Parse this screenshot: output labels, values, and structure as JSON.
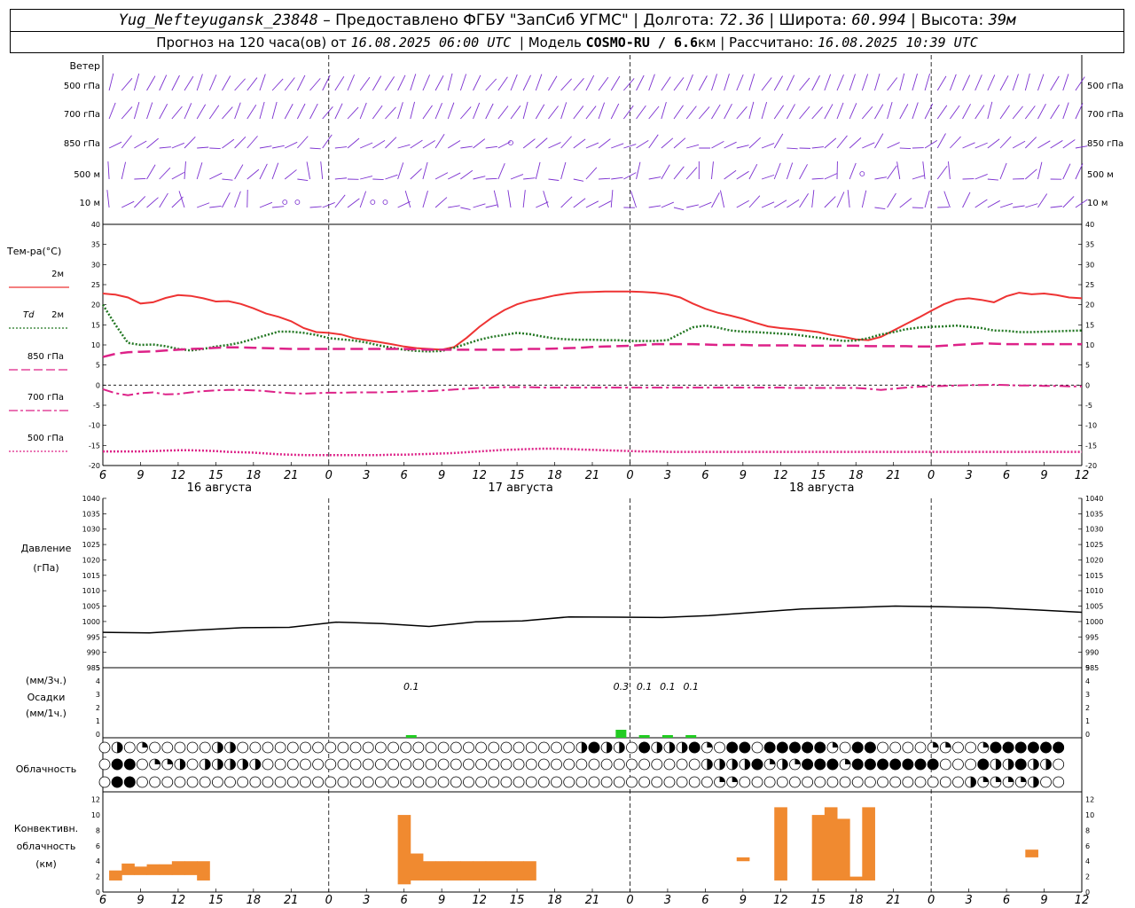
{
  "header": {
    "station": "Yug_Nefteyugansk_23848",
    "dash": " – ",
    "provider": "Предоставлено ФГБУ \"ЗапСиб УГМС\"",
    "lon_label": "Долгота:",
    "lon_value": "72.36",
    "lat_label": "Широта:",
    "lat_value": "60.994",
    "alt_label": "Высота:",
    "alt_value": "39м",
    "sep": " | ",
    "forecast_text": "Прогноз на 120 часа(ов) от ",
    "forecast_time": "16.08.2025 06:00 UTC",
    "model_label": "Модель ",
    "model_name": "COSMO-RU / 6.6",
    "model_res_unit": "км",
    "calc_label": "Рассчитано: ",
    "calc_time": "16.08.2025 10:39 UTC"
  },
  "time_axis": {
    "tick_labels": [
      "6",
      "9",
      "12",
      "15",
      "18",
      "21",
      "0",
      "3",
      "6",
      "9",
      "12",
      "15",
      "18",
      "21",
      "0",
      "3",
      "6",
      "9",
      "12",
      "15",
      "18",
      "21",
      "0",
      "3",
      "6",
      "9",
      "12"
    ],
    "day_labels": [
      "16 августа",
      "17 августа",
      "18 августа"
    ]
  },
  "wind_panel": {
    "title": "Ветер",
    "levels": [
      "500 гПа",
      "700 гПа",
      "850 гПа",
      "500 м",
      "10 м"
    ],
    "colors": {
      "barb": "#7b2fd0",
      "calm_circle": "#7b2fd0"
    }
  },
  "chart_data": [
    {
      "type": "line",
      "title": "Тем-ра(°C)",
      "ylim": [
        -20,
        40
      ],
      "y_ticks": [
        "40",
        "35",
        "30",
        "25",
        "20",
        "15",
        "10",
        "5",
        "0",
        "-5",
        "-10",
        "-15",
        "-20"
      ],
      "x_hours": [
        0,
        1,
        2,
        3,
        4,
        5,
        6,
        7,
        8,
        9,
        10,
        11,
        12,
        13,
        14,
        15,
        16,
        17,
        18,
        19,
        20,
        21,
        22,
        23,
        24,
        25,
        26,
        27,
        28,
        29,
        30,
        31,
        32,
        33,
        34,
        35,
        36,
        37,
        38,
        39,
        40,
        41,
        42,
        43,
        44,
        45,
        46,
        47,
        48,
        49,
        50,
        51,
        52,
        53,
        54,
        55,
        56,
        57,
        58,
        59,
        60,
        61,
        62,
        63,
        64,
        65,
        66,
        67,
        68,
        69,
        70,
        71,
        72,
        73,
        74,
        75,
        76,
        77,
        78
      ],
      "series": [
        {
          "name": "2м",
          "color": "#ee3333",
          "style": "solid",
          "values": [
            22.8,
            22.5,
            21.8,
            20.3,
            20.6,
            21.7,
            22.4,
            22.2,
            21.6,
            20.8,
            20.9,
            20.2,
            19.1,
            17.8,
            17.0,
            15.9,
            14.2,
            13.2,
            13.0,
            12.6,
            11.7,
            11.2,
            10.7,
            10.2,
            9.6,
            9.2,
            9.0,
            8.8,
            9.5,
            11.8,
            14.5,
            16.8,
            18.7,
            20.1,
            21.0,
            21.6,
            22.3,
            22.8,
            23.1,
            23.2,
            23.3,
            23.3,
            23.3,
            23.2,
            23.0,
            22.6,
            21.8,
            20.3,
            19.0,
            18.0,
            17.3,
            16.5,
            15.5,
            14.6,
            14.2,
            13.9,
            13.6,
            13.2,
            12.5,
            12.0,
            11.4,
            11.2,
            12.0,
            13.6,
            15.2,
            16.8,
            18.5,
            20.1,
            21.3,
            21.6,
            21.2,
            20.6,
            22.1,
            23.0,
            22.6,
            22.8,
            22.4,
            21.8,
            21.6
          ]
        },
        {
          "name": "Td 2м",
          "color": "#227722",
          "style": "dotted",
          "values": [
            20.0,
            15.0,
            10.5,
            10.0,
            10.1,
            9.7,
            9.0,
            8.6,
            9.0,
            9.6,
            10.0,
            10.6,
            11.5,
            12.4,
            13.3,
            13.3,
            13.0,
            12.5,
            11.7,
            11.4,
            11.1,
            10.6,
            9.9,
            9.3,
            8.8,
            8.5,
            8.4,
            8.5,
            9.3,
            10.3,
            11.3,
            12.0,
            12.5,
            13.0,
            12.7,
            12.1,
            11.6,
            11.4,
            11.3,
            11.3,
            11.2,
            11.2,
            11.0,
            11.0,
            11.0,
            11.2,
            12.8,
            14.4,
            14.8,
            14.3,
            13.6,
            13.3,
            13.2,
            13.0,
            12.8,
            12.6,
            12.2,
            11.8,
            11.4,
            11.0,
            11.1,
            11.7,
            12.6,
            13.2,
            13.9,
            14.3,
            14.5,
            14.6,
            14.8,
            14.5,
            14.2,
            13.6,
            13.5,
            13.2,
            13.2,
            13.3,
            13.4,
            13.5,
            13.6
          ]
        },
        {
          "name": "850 гПа",
          "color": "#dd2288",
          "style": "longdash",
          "values": [
            7.0,
            7.8,
            8.2,
            8.3,
            8.4,
            8.6,
            8.8,
            9.0,
            9.1,
            9.3,
            9.4,
            9.4,
            9.3,
            9.2,
            9.1,
            9.0,
            9.0,
            9.0,
            9.0,
            9.0,
            9.0,
            9.0,
            9.0,
            9.0,
            9.0,
            8.9,
            8.8,
            8.8,
            8.8,
            8.8,
            8.8,
            8.8,
            8.8,
            8.8,
            9.0,
            9.0,
            9.1,
            9.2,
            9.3,
            9.5,
            9.6,
            9.7,
            9.8,
            10.0,
            10.2,
            10.2,
            10.2,
            10.2,
            10.1,
            10.0,
            10.0,
            10.0,
            9.9,
            9.9,
            9.9,
            9.9,
            9.8,
            9.8,
            9.8,
            9.8,
            9.8,
            9.7,
            9.7,
            9.7,
            9.7,
            9.6,
            9.6,
            9.8,
            10.0,
            10.2,
            10.4,
            10.3,
            10.2,
            10.2,
            10.2,
            10.2,
            10.2,
            10.2,
            10.2
          ]
        },
        {
          "name": "700 гПа",
          "color": "#dd2288",
          "style": "dashdot",
          "values": [
            -1.0,
            -2.0,
            -2.5,
            -2.0,
            -1.8,
            -2.3,
            -2.2,
            -1.8,
            -1.5,
            -1.3,
            -1.2,
            -1.2,
            -1.3,
            -1.5,
            -1.8,
            -2.0,
            -2.1,
            -2.0,
            -1.9,
            -1.9,
            -1.8,
            -1.8,
            -1.8,
            -1.7,
            -1.6,
            -1.5,
            -1.5,
            -1.3,
            -1.1,
            -0.9,
            -0.7,
            -0.6,
            -0.5,
            -0.5,
            -0.5,
            -0.6,
            -0.6,
            -0.6,
            -0.6,
            -0.6,
            -0.6,
            -0.6,
            -0.6,
            -0.6,
            -0.6,
            -0.6,
            -0.6,
            -0.6,
            -0.6,
            -0.6,
            -0.6,
            -0.6,
            -0.6,
            -0.6,
            -0.6,
            -0.7,
            -0.7,
            -0.7,
            -0.7,
            -0.7,
            -0.7,
            -0.9,
            -1.2,
            -0.9,
            -0.6,
            -0.4,
            -0.3,
            -0.2,
            -0.1,
            0.0,
            0.0,
            0.1,
            0.0,
            -0.1,
            -0.1,
            -0.2,
            -0.2,
            -0.3,
            -0.3
          ]
        },
        {
          "name": "500 гПа",
          "color": "#dd2288",
          "style": "dotted",
          "values": [
            -16.5,
            -16.5,
            -16.5,
            -16.5,
            -16.4,
            -16.3,
            -16.2,
            -16.2,
            -16.3,
            -16.4,
            -16.6,
            -16.7,
            -16.8,
            -17.0,
            -17.2,
            -17.3,
            -17.4,
            -17.4,
            -17.4,
            -17.4,
            -17.4,
            -17.4,
            -17.4,
            -17.3,
            -17.3,
            -17.2,
            -17.1,
            -17.0,
            -16.9,
            -16.7,
            -16.5,
            -16.3,
            -16.1,
            -16.0,
            -15.9,
            -15.8,
            -15.8,
            -15.9,
            -16.0,
            -16.1,
            -16.2,
            -16.3,
            -16.4,
            -16.5,
            -16.5,
            -16.6,
            -16.6,
            -16.6,
            -16.6,
            -16.6,
            -16.6,
            -16.6,
            -16.6,
            -16.6,
            -16.6,
            -16.6,
            -16.6,
            -16.6,
            -16.6,
            -16.6,
            -16.6,
            -16.6,
            -16.6,
            -16.6,
            -16.6,
            -16.6,
            -16.6,
            -16.6,
            -16.6,
            -16.6,
            -16.6,
            -16.6,
            -16.6,
            -16.6,
            -16.6,
            -16.6,
            -16.6,
            -16.6,
            -16.6
          ]
        }
      ]
    },
    {
      "type": "line",
      "title": "Давление",
      "ylabel": "(гПа)",
      "ylim": [
        985,
        1040
      ],
      "y_ticks": [
        "1040",
        "1035",
        "1030",
        "1025",
        "1020",
        "1015",
        "1010",
        "1005",
        "1000",
        "995",
        "990",
        "985"
      ],
      "series": [
        {
          "name": "Давление",
          "color": "#000000",
          "x_hours": [
            0,
            6,
            12,
            18,
            24,
            30,
            36,
            42,
            48,
            54,
            60,
            66,
            72,
            78,
            84,
            90,
            96,
            102,
            108,
            114,
            120,
            126
          ],
          "values": [
            996.5,
            996.3,
            997.2,
            998.0,
            998.1,
            999.8,
            999.3,
            998.4,
            999.9,
            1000.2,
            1001.5,
            1001.4,
            1001.3,
            1001.9,
            1003.0,
            1004.1,
            1004.5,
            1005.0,
            1004.8,
            1004.5,
            1003.8,
            1003.0
          ]
        }
      ]
    },
    {
      "type": "bar",
      "title": "Осадки",
      "ylabel": "(мм/3ч.)",
      "ylabel2": "(мм/1ч.)",
      "ylim": [
        0,
        5
      ],
      "y_ticks": [
        "5",
        "4",
        "3",
        "2",
        "1",
        "0"
      ],
      "bar_color": "#22cc22",
      "x_hours": [
        30,
        57,
        60,
        63,
        66
      ],
      "values": [
        0.1,
        0.3,
        0.1,
        0.1,
        0.1
      ],
      "labels": [
        "0.1",
        "0.3",
        "0.1",
        "0.1",
        "0.1"
      ]
    },
    {
      "type": "bar",
      "title": "Конвективн.",
      "ylabel": "облачность",
      "ylabel2": "(км)",
      "ylim": [
        0,
        13
      ],
      "y_ticks": [
        "12",
        "10",
        "8",
        "6",
        "4",
        "2",
        "0"
      ],
      "bar_color": "#f08a30",
      "bars": [
        {
          "x": 1,
          "base": 1.5,
          "top": 2.8
        },
        {
          "x": 2,
          "base": 2.2,
          "top": 3.7
        },
        {
          "x": 3,
          "base": 2.2,
          "top": 3.3
        },
        {
          "x": 4,
          "base": 2.2,
          "top": 3.6
        },
        {
          "x": 5,
          "base": 2.2,
          "top": 3.6
        },
        {
          "x": 6,
          "base": 2.2,
          "top": 4.0
        },
        {
          "x": 7,
          "base": 2.2,
          "top": 4.0
        },
        {
          "x": 8,
          "base": 1.5,
          "top": 4.0
        },
        {
          "x": 24,
          "base": 1.0,
          "top": 10.0
        },
        {
          "x": 25,
          "base": 1.5,
          "top": 5.0
        },
        {
          "x": 26,
          "base": 1.5,
          "top": 4.0
        },
        {
          "x": 27,
          "base": 1.5,
          "top": 4.0
        },
        {
          "x": 28,
          "base": 1.5,
          "top": 4.0
        },
        {
          "x": 29,
          "base": 1.5,
          "top": 4.0
        },
        {
          "x": 30,
          "base": 1.5,
          "top": 4.0
        },
        {
          "x": 31,
          "base": 1.5,
          "top": 4.0
        },
        {
          "x": 32,
          "base": 1.5,
          "top": 4.0
        },
        {
          "x": 33,
          "base": 1.5,
          "top": 4.0
        },
        {
          "x": 34,
          "base": 1.5,
          "top": 4.0
        },
        {
          "x": 51,
          "base": 4.0,
          "top": 4.5
        },
        {
          "x": 54,
          "base": 1.5,
          "top": 11.0
        },
        {
          "x": 57,
          "base": 1.5,
          "top": 10.0
        },
        {
          "x": 58,
          "base": 1.5,
          "top": 11.0
        },
        {
          "x": 59,
          "base": 1.5,
          "top": 9.5
        },
        {
          "x": 60,
          "base": 1.5,
          "top": 2.0
        },
        {
          "x": 61,
          "base": 1.5,
          "top": 11.0
        },
        {
          "x": 74,
          "base": 4.5,
          "top": 5.5
        }
      ]
    }
  ],
  "cloud_panel": {
    "title": "Облачность",
    "rows": [
      "0h0q00000hh000000000000000000000000000hfhh0fhhhfq0ff0fffffq0ff0000qq00qffffff",
      "0ff0qqh0hhhhh00000000000000000000000000000000000hhhhfqhqfffqfffffff000fhhfhh0",
      "0ff0000000000000000000000000000000000000000000000qq000000000000000000hqqqqh00"
    ],
    "legend": {
      "0": "clear",
      "q": "quarter",
      "h": "half",
      "t": "three-quarter",
      "f": "overcast"
    }
  },
  "temp_legend": {
    "t2m": "2м",
    "td_prefix": "Td",
    "td": "2м",
    "p850": "850 гПа",
    "p700": "700 гПа",
    "p500": "500 гПа"
  }
}
